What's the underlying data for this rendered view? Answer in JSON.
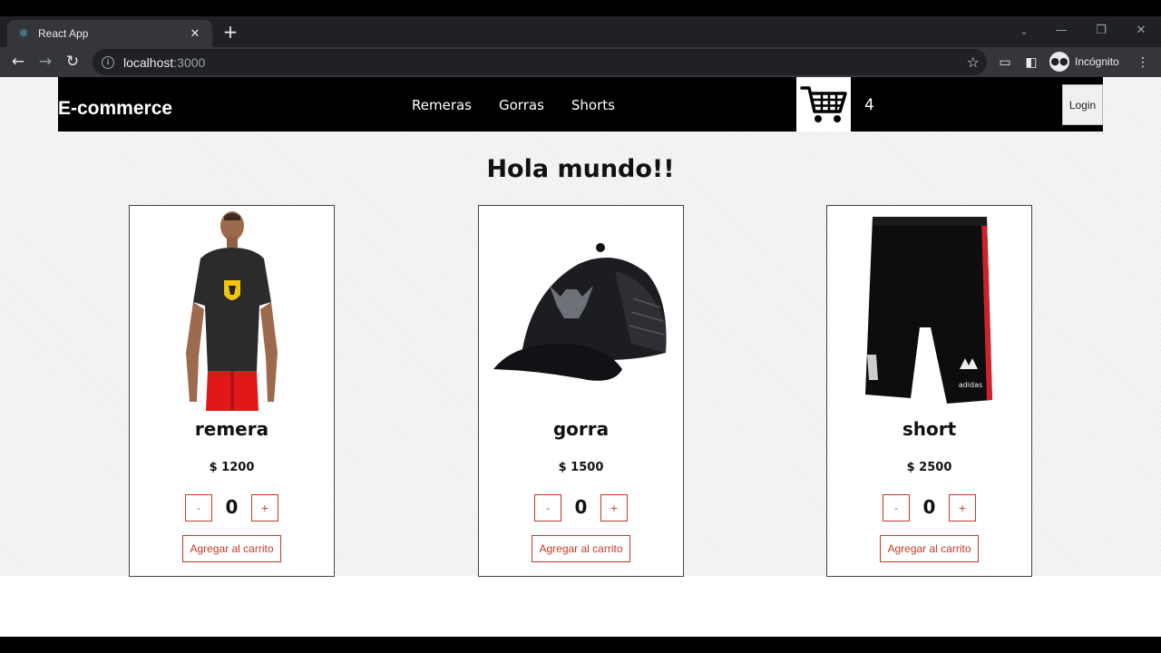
{
  "browser": {
    "tab_title": "React App",
    "tab_close": "✕",
    "new_tab": "+",
    "url_host": "localhost",
    "url_port": ":3000",
    "profile_label": "Incógnito",
    "icons": [
      "react-favicon",
      "close-icon",
      "plus-icon",
      "back-icon",
      "forward-icon",
      "reload-icon",
      "info-icon",
      "star-icon",
      "cast-icon",
      "sidebar-icon",
      "incognito-icon",
      "menu-icon"
    ]
  },
  "navbar": {
    "brand": "E-commerce",
    "links": [
      "Remeras",
      "Gorras",
      "Shorts"
    ],
    "cart_count": "4",
    "login_label": "Login"
  },
  "main": {
    "heading": "Hola mundo!!"
  },
  "products": [
    {
      "name": "remera",
      "price": "$ 1200",
      "qty": "0",
      "minus": "-",
      "plus": "+",
      "add_label": "Agregar al carrito"
    },
    {
      "name": "gorra",
      "price": "$ 1500",
      "qty": "0",
      "minus": "-",
      "plus": "+",
      "add_label": "Agregar al carrito"
    },
    {
      "name": "short",
      "price": "$ 2500",
      "qty": "0",
      "minus": "-",
      "plus": "+",
      "add_label": "Agregar al carrito"
    }
  ],
  "colors": {
    "navbar_bg": "#000000",
    "accent_red": "#c0392b",
    "chrome_dark": "#202124",
    "chrome_toolbar": "#35363a"
  }
}
